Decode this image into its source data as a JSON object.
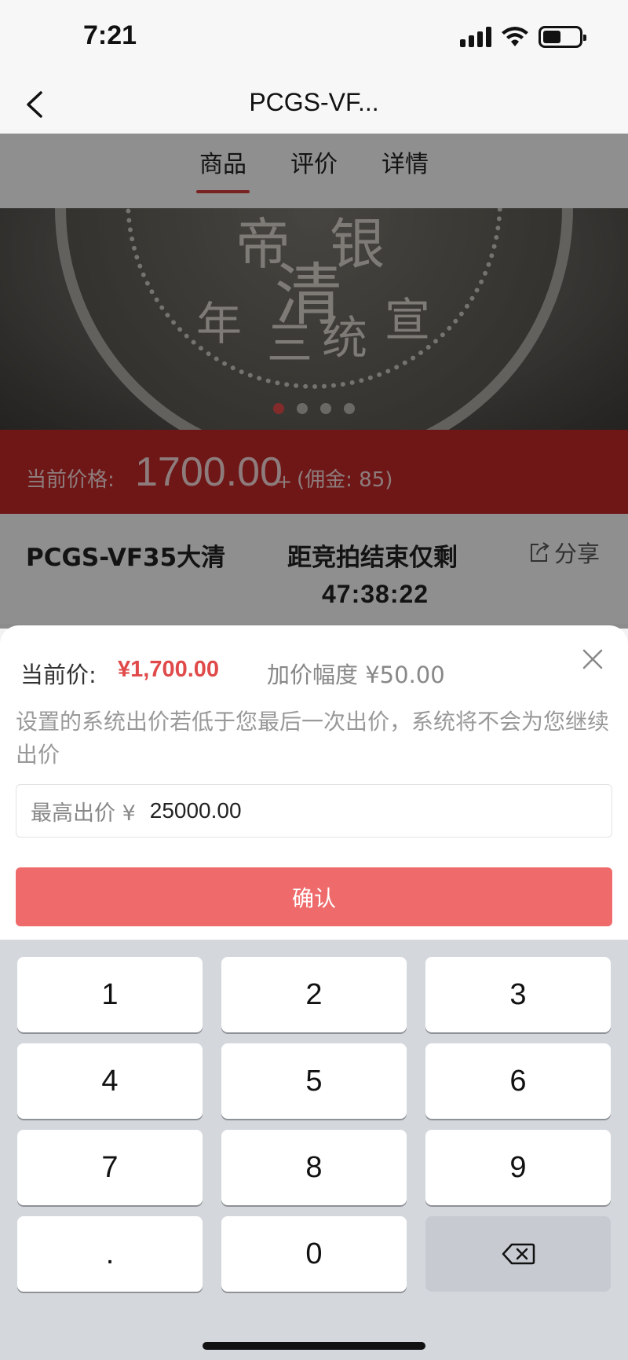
{
  "status_bar": {
    "time": "7:21"
  },
  "nav": {
    "title": "PCGS-VF..."
  },
  "tabs": [
    {
      "label": "商品",
      "active": true
    },
    {
      "label": "评价",
      "active": false
    },
    {
      "label": "详情",
      "active": false
    }
  ],
  "carousel": {
    "count": 4,
    "active_index": 0
  },
  "price_strip": {
    "label": "当前价格:",
    "value": "1700.00",
    "plus": "+",
    "commission": "(佣金: 85)"
  },
  "info": {
    "product_name": "PCGS-VF35大清",
    "countdown_label": "距竞拍结束仅剩",
    "countdown": "47:38:22",
    "share_label": "分享"
  },
  "sheet": {
    "current_label": "当前价:",
    "current_value": "¥1,700.00",
    "increment_label": "加价幅度 ¥50.00",
    "notice": "设置的系统出价若低于您最后一次出价，系统将不会为您继续出价",
    "field_label": "最高出价 ¥",
    "field_value": "25000.00",
    "confirm_label": "确认"
  },
  "keypad": {
    "keys": [
      "1",
      "2",
      "3",
      "4",
      "5",
      "6",
      "7",
      "8",
      "9",
      ".",
      "0"
    ]
  },
  "colors": {
    "accent": "#e04a4a",
    "confirm": "#ef6b6b",
    "price_strip": "#c02828"
  }
}
